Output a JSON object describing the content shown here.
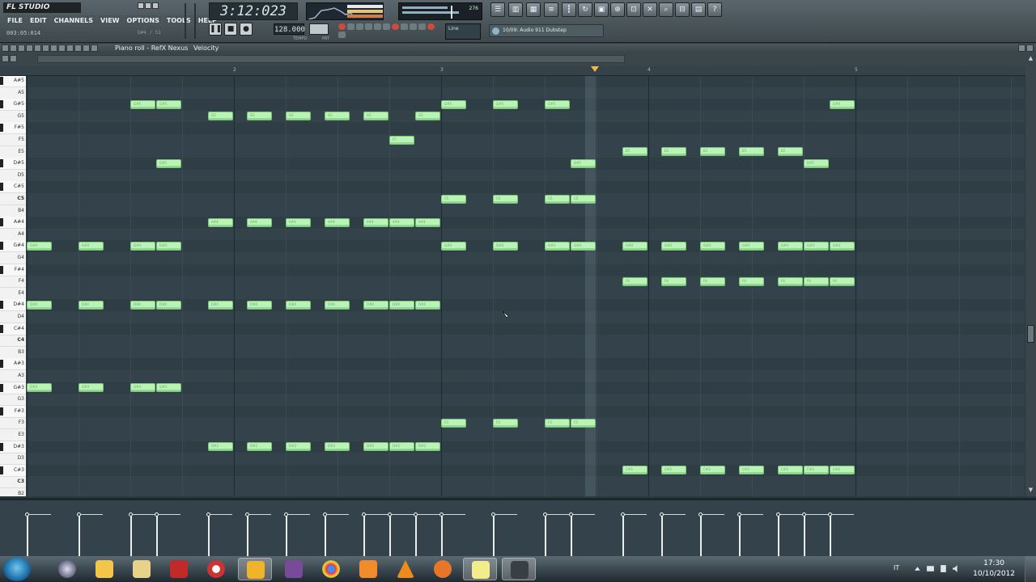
{
  "app": {
    "logo_text": "FL STUDIO",
    "song_position": "003:05:014",
    "song_position_right": "D#4 / 51",
    "time_display": "3:12:023",
    "tempo": "128.000",
    "tempo_label": "TEMPO",
    "pattern_label": "PAT",
    "cpu_label": "276",
    "snap_value": "Line",
    "hint_text": "10/09: Audio 911 Dubstep"
  },
  "menu": [
    "FILE",
    "EDIT",
    "CHANNELS",
    "VIEW",
    "OPTIONS",
    "TOOLS",
    "HELP"
  ],
  "piano_roll": {
    "title": "Piano roll - RefX Nexus",
    "target": "Velocity",
    "bar_numbers": [
      "2",
      "3",
      "4",
      "5"
    ]
  },
  "keys": [
    "A#5",
    "A5",
    "G#5",
    "G5",
    "F#5",
    "F5",
    "E5",
    "D#5",
    "D5",
    "C#5",
    "C5",
    "B4",
    "A#4",
    "A4",
    "G#4",
    "G4",
    "F#4",
    "F4",
    "E4",
    "D#4",
    "D4",
    "C#4",
    "C4",
    "B3",
    "A#3",
    "A3",
    "G#3",
    "G3",
    "F#3",
    "F3",
    "E3",
    "D#3",
    "D3",
    "C#3",
    "C3",
    "B2"
  ],
  "notes": [
    {
      "key": "G#5",
      "steps": [
        8,
        10
      ],
      "label": "G#5"
    },
    {
      "key": "G5",
      "steps": [
        14,
        17,
        20,
        23,
        26,
        30
      ],
      "label": "G5"
    },
    {
      "key": "G#5",
      "steps": [
        32,
        36,
        40,
        62
      ],
      "label": "G#5"
    },
    {
      "key": "F5",
      "steps": [
        28
      ],
      "label": "F5"
    },
    {
      "key": "E5",
      "steps": [
        46,
        49,
        52,
        55,
        58
      ],
      "label": "E5"
    },
    {
      "key": "D#5",
      "steps": [
        10,
        42,
        60
      ],
      "label": "D#5"
    },
    {
      "key": "C5",
      "steps": [
        32,
        36,
        40,
        42
      ],
      "label": "C5"
    },
    {
      "key": "A#4",
      "steps": [
        14,
        17,
        20,
        23,
        26,
        28,
        30
      ],
      "label": "A#4"
    },
    {
      "key": "G#4",
      "steps": [
        0,
        4,
        8,
        10,
        32,
        36,
        40,
        42,
        46,
        49,
        52,
        55,
        58,
        60,
        62
      ],
      "label": "G#4"
    },
    {
      "key": "F4",
      "steps": [
        46,
        49,
        52,
        55,
        58,
        60,
        62
      ],
      "label": "F4"
    },
    {
      "key": "D#4",
      "steps": [
        0,
        4,
        8,
        10,
        14,
        17,
        20,
        23,
        26,
        28,
        30
      ],
      "label": "D#4"
    },
    {
      "key": "G#3",
      "steps": [
        0,
        4,
        8,
        10
      ],
      "label": "G#3"
    },
    {
      "key": "F3",
      "steps": [
        32,
        36,
        40,
        42
      ],
      "label": "F3"
    },
    {
      "key": "D#3",
      "steps": [
        14,
        17,
        20,
        23,
        26,
        28,
        30
      ],
      "label": "D#3"
    },
    {
      "key": "C#3",
      "steps": [
        46,
        49,
        52,
        55,
        58,
        60,
        62
      ],
      "label": "C#3"
    }
  ],
  "taskbar": {
    "language": "IT",
    "time": "17:30",
    "date": "10/10/2012"
  }
}
